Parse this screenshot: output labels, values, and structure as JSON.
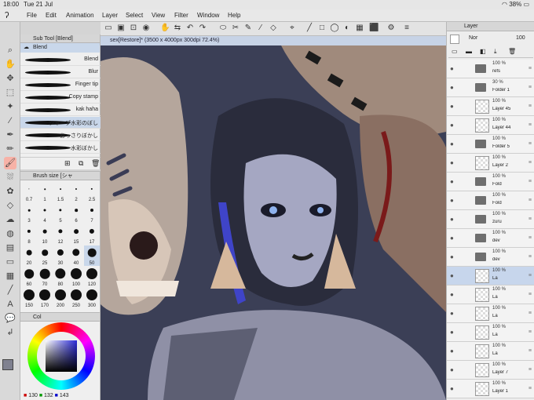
{
  "status": {
    "time": "18:00",
    "date": "Tue 21 Jul",
    "battery": "38%"
  },
  "menu": [
    "File",
    "Edit",
    "Animation",
    "Layer",
    "Select",
    "View",
    "Filter",
    "Window",
    "Help"
  ],
  "subtool": {
    "header": "Sub Tool [Blend]",
    "active_tab": "Blend",
    "brushes": [
      "Blend",
      "Blur",
      "Finger tip",
      "Copy stamp",
      "kak haha",
      "シャープ水彩のぼし",
      "あっさりぼかし",
      "水彩ぼかし"
    ]
  },
  "brushsize": {
    "header": "Brush size [シャ",
    "sizes": [
      "0.7",
      "1",
      "1.5",
      "2",
      "2.5",
      "3",
      "4",
      "5",
      "6",
      "7",
      "8",
      "10",
      "12",
      "15",
      "17",
      "20",
      "25",
      "30",
      "40",
      "50",
      "60",
      "70",
      "80",
      "100",
      "120",
      "150",
      "170",
      "200",
      "250",
      "300"
    ]
  },
  "colorpanel": {
    "header": "Col",
    "r": "130",
    "g": "132",
    "b": "143"
  },
  "canvas": {
    "tab": "sex[Restore]* (3500 x 4000px 300dpi 72.4%)"
  },
  "layerpanel": {
    "header": "Layer",
    "blend_mode": "Nor",
    "opacity": "100",
    "layers": [
      {
        "pct": "100 %",
        "name": "refs",
        "folder": true
      },
      {
        "pct": "30 %",
        "name": "Folder 1",
        "folder": true
      },
      {
        "pct": "100 %",
        "name": "Layer 45",
        "folder": false
      },
      {
        "pct": "100 %",
        "name": "Layer 44",
        "folder": false
      },
      {
        "pct": "100 %",
        "name": "Folder 5",
        "folder": true
      },
      {
        "pct": "100 %",
        "name": "Layer 2",
        "folder": false
      },
      {
        "pct": "100 %",
        "name": "Fold",
        "folder": true
      },
      {
        "pct": "100 %",
        "name": "Fold",
        "folder": true
      },
      {
        "pct": "100 %",
        "name": "zuru",
        "folder": true
      },
      {
        "pct": "100 %",
        "name": "dev",
        "folder": true
      },
      {
        "pct": "100 %",
        "name": "dev",
        "folder": true
      },
      {
        "pct": "100 %",
        "name": "La",
        "folder": false
      },
      {
        "pct": "100 %",
        "name": "La",
        "folder": false
      },
      {
        "pct": "100 %",
        "name": "La",
        "folder": false
      },
      {
        "pct": "100 %",
        "name": "La",
        "folder": false
      },
      {
        "pct": "100 %",
        "name": "La",
        "folder": false
      },
      {
        "pct": "100 %",
        "name": "Layer 7",
        "folder": false
      },
      {
        "pct": "100 %",
        "name": "Layer 1",
        "folder": false
      }
    ]
  }
}
